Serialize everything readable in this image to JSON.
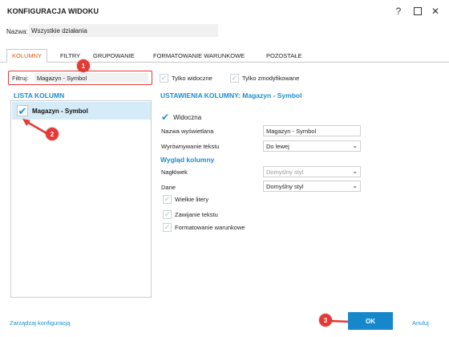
{
  "window": {
    "title": "KONFIGURACJA WIDOKU",
    "help_glyph": "?",
    "close_glyph": "✕"
  },
  "name_row": {
    "label": "Nazwa:",
    "value": "Wszystkie działania"
  },
  "tabs": [
    {
      "label": "KOLUMNY",
      "active": true
    },
    {
      "label": "FILTRY",
      "active": false
    },
    {
      "label": "GRUPOWANIE",
      "active": false
    },
    {
      "label": "FORMATOWANIE WARUNKOWE",
      "active": false
    },
    {
      "label": "POZOSTAŁE",
      "active": false
    }
  ],
  "filter": {
    "label": "Filtruj:",
    "value": "Magazyn - Symbol"
  },
  "top_checks": {
    "only_visible": "Tylko widoczne",
    "only_modified": "Tylko zmodyfikowane"
  },
  "column_list": {
    "title": "LISTA KOLUMN",
    "items": [
      {
        "label": "Magazyn - Symbol",
        "checked": true
      }
    ]
  },
  "settings": {
    "title": "USTAWIENIA KOLUMNY: Magazyn - Symbol",
    "visible_label": "Widoczna",
    "display_name_label": "Nazwa wyświetlana",
    "display_name_value": "Magazyn - Symbol",
    "align_label": "Wyrównywanie tekstu",
    "align_value": "Do lewej",
    "appearance_title": "Wygląd kolumny",
    "header_label": "Nagłówek",
    "header_value": "Domyślny styl",
    "data_label": "Dane",
    "data_value": "Domyślny styl",
    "uppercase_label": "Wielkie litery",
    "wrap_label": "Zawijanie tekstu",
    "conditional_label": "Formatowanie warunkowe"
  },
  "annotations": [
    "1",
    "2",
    "3"
  ],
  "footer": {
    "manage_link": "Zarządzaj konfiguracją",
    "ok_label": "OK",
    "cancel_link": "Anuluj"
  },
  "colors": {
    "accent_blue": "#1a8fd0",
    "tab_active": "#e05a1a",
    "annotation_red": "#e53935",
    "ok_button": "#1787cc",
    "selected_row": "#d6ebf8"
  }
}
